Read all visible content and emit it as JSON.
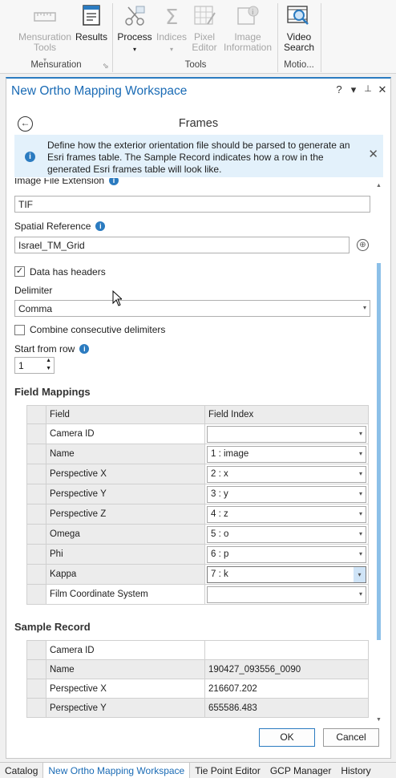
{
  "ribbon": {
    "mensuration_tools_label": "Mensuration Tools",
    "results_label": "Results",
    "mensuration_group": "Mensuration",
    "process_label": "Process",
    "indices_label": "Indices",
    "pixel_editor_label": "Pixel Editor",
    "image_information_label": "Image Information",
    "tools_group": "Tools",
    "video_search_label": "Video Search",
    "motion_group": "Motio..."
  },
  "pane": {
    "title": "New Ortho Mapping Workspace",
    "help": "?",
    "menu": "▾",
    "pin": "📌",
    "close": "✕"
  },
  "step": {
    "title": "Frames",
    "info_message": "Define how the exterior orientation file should be parsed to generate an Esri frames table. The Sample Record indicates how a row in the generated Esri frames table will look like."
  },
  "form": {
    "image_ext_label": "Image File Extension",
    "image_ext_value": "TIF",
    "spatial_ref_label": "Spatial Reference",
    "spatial_ref_value": "Israel_TM_Grid",
    "headers_label": "Data has headers",
    "headers_checked": true,
    "delimiter_label": "Delimiter",
    "delimiter_value": "Comma",
    "combine_label": "Combine consecutive delimiters",
    "combine_checked": false,
    "start_row_label": "Start from row",
    "start_row_value": "1"
  },
  "field_mappings": {
    "title": "Field Mappings",
    "col_field": "Field",
    "col_index": "Field Index",
    "rows": [
      {
        "field": "Camera ID",
        "index": ""
      },
      {
        "field": "Name",
        "index": "1 : image"
      },
      {
        "field": "Perspective X",
        "index": "2 : x"
      },
      {
        "field": "Perspective Y",
        "index": "3 : y"
      },
      {
        "field": "Perspective Z",
        "index": "4 : z"
      },
      {
        "field": "Omega",
        "index": "5 : o"
      },
      {
        "field": "Phi",
        "index": "6 : p"
      },
      {
        "field": "Kappa",
        "index": "7 : k"
      },
      {
        "field": "Film Coordinate System",
        "index": ""
      }
    ]
  },
  "sample_record": {
    "title": "Sample Record",
    "rows": [
      {
        "field": "Camera ID",
        "value": ""
      },
      {
        "field": "Name",
        "value": "190427_093556_0090"
      },
      {
        "field": "Perspective X",
        "value": "216607.202"
      },
      {
        "field": "Perspective Y",
        "value": "655586.483"
      }
    ]
  },
  "buttons": {
    "ok": "OK",
    "cancel": "Cancel"
  },
  "bottom_tabs": [
    "Catalog",
    "New Ortho Mapping Workspace",
    "Tie Point Editor",
    "GCP Manager",
    "History"
  ],
  "colors": {
    "accent": "#1a6bb5",
    "banner_bg": "#e3f1fb",
    "scroll_thumb": "#8cc0e8"
  }
}
